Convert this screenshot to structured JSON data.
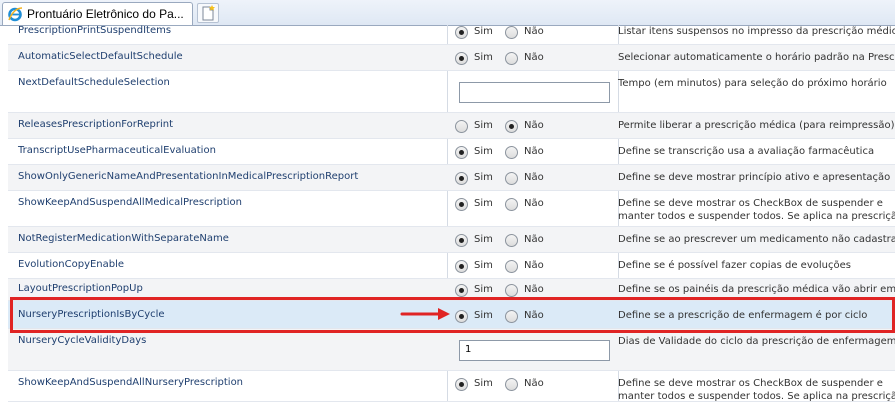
{
  "tab": {
    "title": "Prontuário Eletrônico do Pa..."
  },
  "options": {
    "sim": "Sim",
    "nao": "Não"
  },
  "rows": [
    {
      "name": "PrescriptionPrintSuspendItems",
      "desc": [
        "Listar itens suspensos no impresso da prescrição médica"
      ],
      "control": "radio",
      "selected": "sim"
    },
    {
      "name": "AutomaticSelectDefaultSchedule",
      "desc": [
        "Selecionar automaticamente o horário padrão na Prescrição"
      ],
      "control": "radio",
      "selected": "sim"
    },
    {
      "name": "NextDefaultScheduleSelection",
      "desc": [
        "Tempo (em minutos) para seleção do próximo horário"
      ],
      "control": "text",
      "value": ""
    },
    {
      "name": "ReleasesPrescriptionForReprint",
      "desc": [
        "Permite liberar a prescrição médica (para reimpressão)"
      ],
      "control": "radio",
      "selected": "nao"
    },
    {
      "name": "TranscriptUsePharmaceuticalEvaluation",
      "desc": [
        "Define se transcrição usa a avaliação farmacêutica"
      ],
      "control": "radio",
      "selected": "sim"
    },
    {
      "name": "ShowOnlyGenericNameAndPresentationInMedicalPrescriptionReport",
      "desc": [
        "Define se deve mostrar princípio ativo e apresentação"
      ],
      "control": "radio",
      "selected": "sim"
    },
    {
      "name": "ShowKeepAndSuspendAllMedicalPrescription",
      "desc": [
        "Define se deve mostrar os CheckBox de suspender e",
        "manter todos e suspender todos. Se aplica na prescrição"
      ],
      "control": "radio",
      "selected": "sim"
    },
    {
      "name": "NotRegisterMedicationWithSeparateName",
      "desc": [
        "Define se ao prescrever um medicamento não cadastrado"
      ],
      "control": "radio",
      "selected": "sim"
    },
    {
      "name": "EvolutionCopyEnable",
      "desc": [
        "Define se é possível fazer copias de evoluções"
      ],
      "control": "radio",
      "selected": "sim"
    },
    {
      "name": "LayoutPrescriptionPopUp",
      "desc": [
        "Define se os painéis da prescrição médica vão abrir em"
      ],
      "control": "radio",
      "selected": "sim"
    },
    {
      "name": "NurseryPrescriptionIsByCycle",
      "desc": [
        "Define se a prescrição de enfermagem é por ciclo"
      ],
      "control": "radio",
      "selected": "sim"
    },
    {
      "name": "NurseryCycleValidityDays",
      "desc": [
        "Dias de Validade do ciclo da prescrição de enfermagem"
      ],
      "control": "text",
      "value": "1"
    },
    {
      "name": "ShowKeepAndSuspendAllNurseryPrescription",
      "desc": [
        "Define se deve mostrar os CheckBox de suspender e",
        "manter todos e suspender todos. Se aplica na prescrição"
      ],
      "control": "radio",
      "selected": "sim"
    }
  ],
  "highlight": {
    "row": "NurseryPrescriptionIsByCycle",
    "color": "#e02424"
  }
}
